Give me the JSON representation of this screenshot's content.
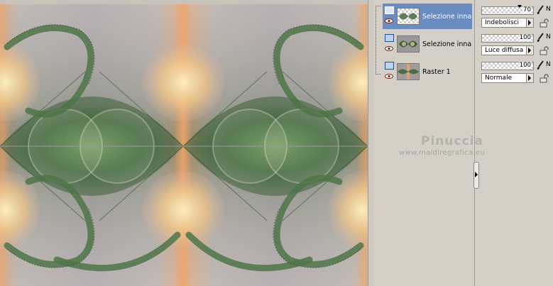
{
  "layers": [
    {
      "name": "Selezione innalzata",
      "selected": true,
      "visible": true
    },
    {
      "name": "Selezione innalzata",
      "selected": false,
      "visible": true
    },
    {
      "name": "Raster 1",
      "selected": false,
      "visible": true
    }
  ],
  "layer_props": [
    {
      "opacity": "70",
      "blend_mode": "Indebolisci",
      "extra": "N"
    },
    {
      "opacity": "100",
      "blend_mode": "Luce diffusa",
      "extra": "N"
    },
    {
      "opacity": "100",
      "blend_mode": "Normale",
      "extra": "N"
    }
  ],
  "watermark": {
    "name": "Pinuccia",
    "url": "www.maidiregrafica.eu"
  },
  "colors": {
    "selected_row": "#6a8cc0",
    "panel_bg": "#d4d0c8",
    "artwork_green": "#3f6a3c",
    "artwork_peach": "#f1c78a",
    "artwork_mauve": "#a49a9c"
  }
}
